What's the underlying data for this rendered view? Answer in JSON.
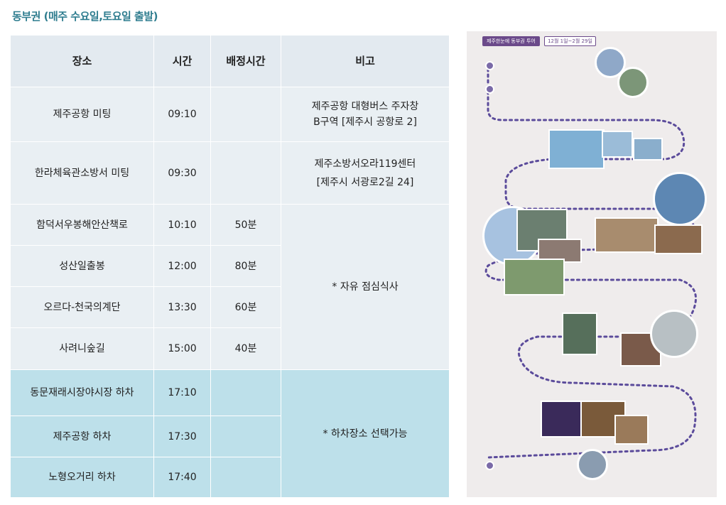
{
  "heading": "동부권 (매주 수요일,토요일 출발)",
  "columns": [
    "장소",
    "시간",
    "배정시간",
    "비고"
  ],
  "rows": [
    {
      "place": "제주공항 미팅",
      "time": "09:10",
      "alloc": ""
    },
    {
      "place": "한라체육관소방서 미팅",
      "time": "09:30",
      "alloc": ""
    },
    {
      "place": "함덕서우봉해안산책로",
      "time": "10:10",
      "alloc": "50분"
    },
    {
      "place": "성산일출봉",
      "time": "12:00",
      "alloc": "80분"
    },
    {
      "place": "오르다-천국의계단",
      "time": "13:30",
      "alloc": "60분"
    },
    {
      "place": "사려니숲길",
      "time": "15:00",
      "alloc": "40분"
    },
    {
      "place": "동문재래시장야시장 하차",
      "time": "17:10",
      "alloc": ""
    },
    {
      "place": "제주공항 하차",
      "time": "17:30",
      "alloc": ""
    },
    {
      "place": "노형오거리 하차",
      "time": "17:40",
      "alloc": ""
    }
  ],
  "notes": {
    "airport_line1": "제주공항 대형버스 주자창",
    "airport_line2": "B구역 [제주시 공항로 2]",
    "station_line1": "제주소방서오라119센터",
    "station_line2": "[제주시 서광로2길 24]",
    "lunch": "* 자유 점심식사",
    "dropoff": "* 하차장소 선택가능"
  },
  "map": {
    "banner": "제주한눈에 동부권 투어",
    "date": "12월 1일~2월 29일",
    "colors": {
      "route": "#5b4b9b",
      "panel": "#efecec"
    }
  }
}
